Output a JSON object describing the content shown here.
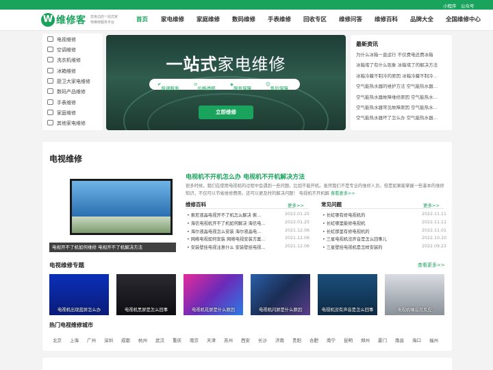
{
  "topbar": {
    "links": [
      "小程序",
      "公众号"
    ]
  },
  "header": {
    "logo_letter": "W",
    "brand": "维修客",
    "slogan": [
      "您身边的一站式家",
      "电维修服务平台"
    ],
    "nav": [
      "首页",
      "家电维修",
      "家庭维修",
      "数码维修",
      "手表维修",
      "回收专区",
      "维修问答",
      "维修百科",
      "品牌大全",
      "全国维修中心"
    ]
  },
  "categories": [
    "电视维修",
    "空调维修",
    "洗衣机维修",
    "冰箱维修",
    "厨卫大家电维修",
    "数码产品维修",
    "手表维修",
    "家庭维修",
    "其他家电维修"
  ],
  "banner": {
    "title_bold": "一站式",
    "title_rest": "家电维修",
    "features": [
      "极速服务",
      "价格透明",
      "服务保障",
      "售后保障"
    ],
    "button": "立即维修"
  },
  "news": {
    "title": "最新资讯",
    "items": [
      "为什么冰箱一直运行 不仅费电还费冰箱",
      "冰箱堵了有什么现象 冰箱堵了的解决方法",
      "冰箱冷藏不制冷的原因 冰箱冷藏不制冷…",
      "空气能热水器的维护方法 空气能热水器…",
      "空气能热水器故障维修原因 空气能热水…",
      "空气能热水器常见故障原因 空气能热水…",
      "空气能热水器坏了怎么办 空气能热水器…"
    ]
  },
  "tv_section": {
    "title": "电视维修",
    "image_caption": "电视开不了机如何维修 电视开不了机解决方法",
    "headline": "电视机不开机怎么办 电视机不开机解决方法",
    "desc": "很多时候，我们在使用电视机的过程中会遇到一些问题，比如不能开机。虽然我们不是专业的维修人员，但是如果能掌握一些基本的维修知识，不仅可以节省维修费用，还可以更及时的解决问题！ 电视机不开机解",
    "desc_more": "查看更多>>",
    "encyclopedia": {
      "title": "维修百科",
      "more": "更多>>",
      "items": [
        {
          "text": "索尼液晶电视开不了机怎么解决 索…",
          "date": "2022.01.25"
        },
        {
          "text": "海信电视机开不了机如何解决 海信电…",
          "date": "2022.01.25"
        },
        {
          "text": "海尔液晶电视怎么安装 海尔液晶电…",
          "date": "2021.12.06"
        },
        {
          "text": "网络电视如何安装 网络电视安装方案…",
          "date": "2021.12.06"
        },
        {
          "text": "安装壁挂电视注意什么 安装壁挂电视…",
          "date": "2021.12.06"
        }
      ]
    },
    "faq": {
      "title": "常见问题",
      "more": "更多>>",
      "items": [
        {
          "text": "长虹哪有修电视机的",
          "date": "2022.11.11"
        },
        {
          "text": "长虹哪里能修电视机",
          "date": "2022.11.11"
        },
        {
          "text": "长虹那里有修电视机的",
          "date": "2022.11.01"
        },
        {
          "text": "三星电视机没声音是怎么回事儿",
          "date": "2022.10.10"
        },
        {
          "text": "三星壁挂电视机是怎样安装的",
          "date": "2022.09.23"
        }
      ]
    },
    "topics": {
      "title": "电视维修专题",
      "more": "查看更多>>",
      "items": [
        "电视机出现蓝屏怎么办",
        "电视机黑屏是怎么回事",
        "电视机花屏是什么原因",
        "电视机闪屏是什么原因",
        "电视机没有声音是怎么回事",
        "电视机噪音没反应"
      ]
    },
    "cities": {
      "title": "热门电视维修城市",
      "items": [
        "北京",
        "上海",
        "广州",
        "深圳",
        "成都",
        "杭州",
        "武汉",
        "重庆",
        "南京",
        "天津",
        "苏州",
        "西安",
        "长沙",
        "济南",
        "贵阳",
        "合肥",
        "南宁",
        "昆明",
        "郑州",
        "厦门",
        "南昌",
        "海口",
        "福州"
      ]
    }
  },
  "colors": {
    "brand": "#19a35c",
    "banner_bg": "#254a3e"
  }
}
